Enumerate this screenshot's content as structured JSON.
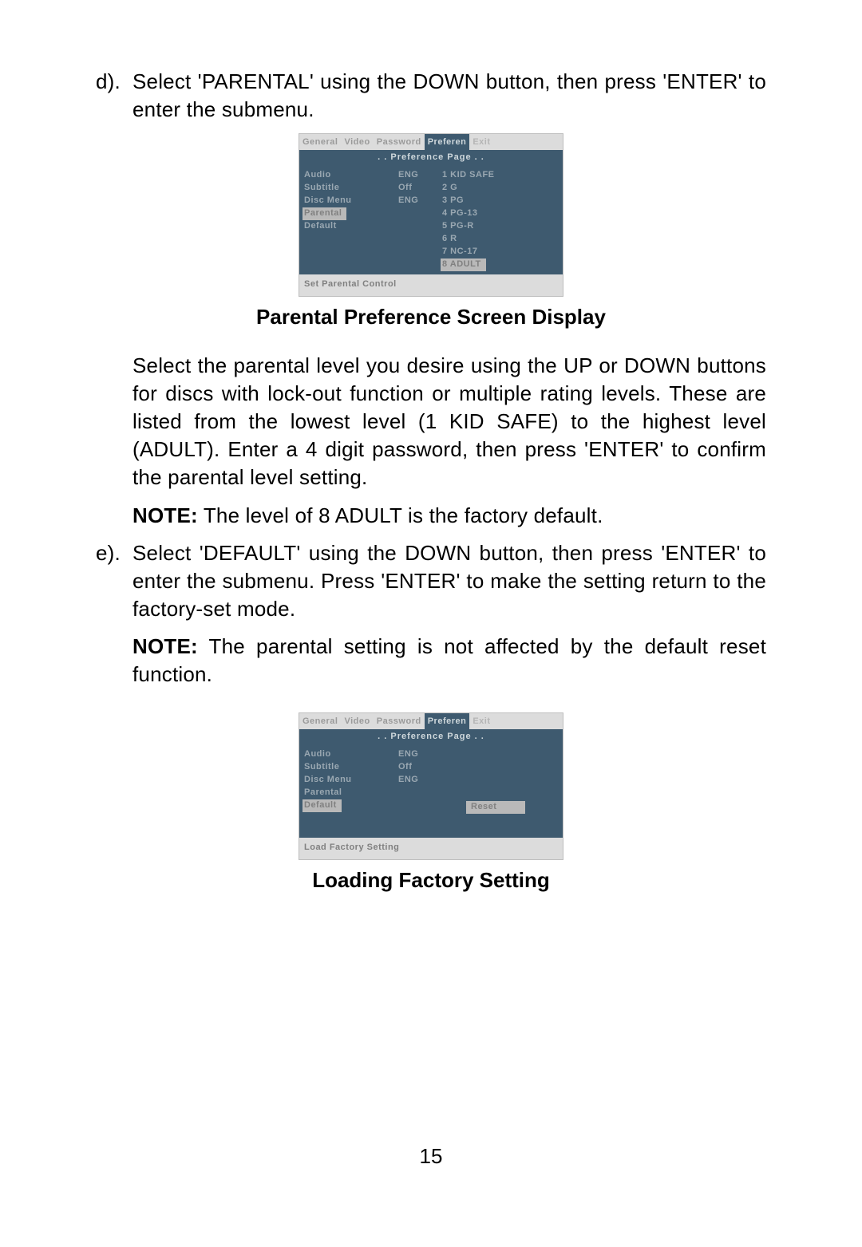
{
  "sections": {
    "d": {
      "label": "d).",
      "text": "Select 'PARENTAL' using the DOWN button, then press 'ENTER' to enter the submenu."
    },
    "caption1": "Parental Preference Screen Display",
    "p1": "Select the parental level you desire using the UP or DOWN buttons for discs with lock-out function or multiple rating levels. These are listed from the lowest level (1 KID SAFE) to the highest level (ADULT). Enter a 4 digit password, then press 'ENTER' to confirm the parental level setting.",
    "note1_label": "NOTE:",
    "note1": " The level of 8 ADULT is the factory default.",
    "e": {
      "label": "e).",
      "text": "Select 'DEFAULT' using the DOWN button, then press 'ENTER' to enter the submenu. Press 'ENTER' to make the setting return to the factory-set mode."
    },
    "note2_label": "NOTE:",
    "note2": " The parental setting is not affected by the default reset function.",
    "caption2": "Loading Factory Setting",
    "page_number": "15"
  },
  "osd": {
    "tabs": [
      "General",
      "Video",
      "Password",
      "Preferen",
      "Exit"
    ],
    "title": ". . Preference Page . .",
    "menu": {
      "items": [
        "Audio",
        "Subtitle",
        "Disc Menu",
        "Parental",
        "Default"
      ],
      "values": [
        "ENG",
        "Off",
        "ENG"
      ]
    },
    "ratings": [
      "1 KID SAFE",
      "2 G",
      "3 PG",
      "4 PG-13",
      "5 PG-R",
      "6 R",
      "7 NC-17",
      "8 ADULT"
    ],
    "footer1": "Set Parental Control",
    "reset_label": "Reset",
    "footer2": "Load Factory Setting"
  }
}
